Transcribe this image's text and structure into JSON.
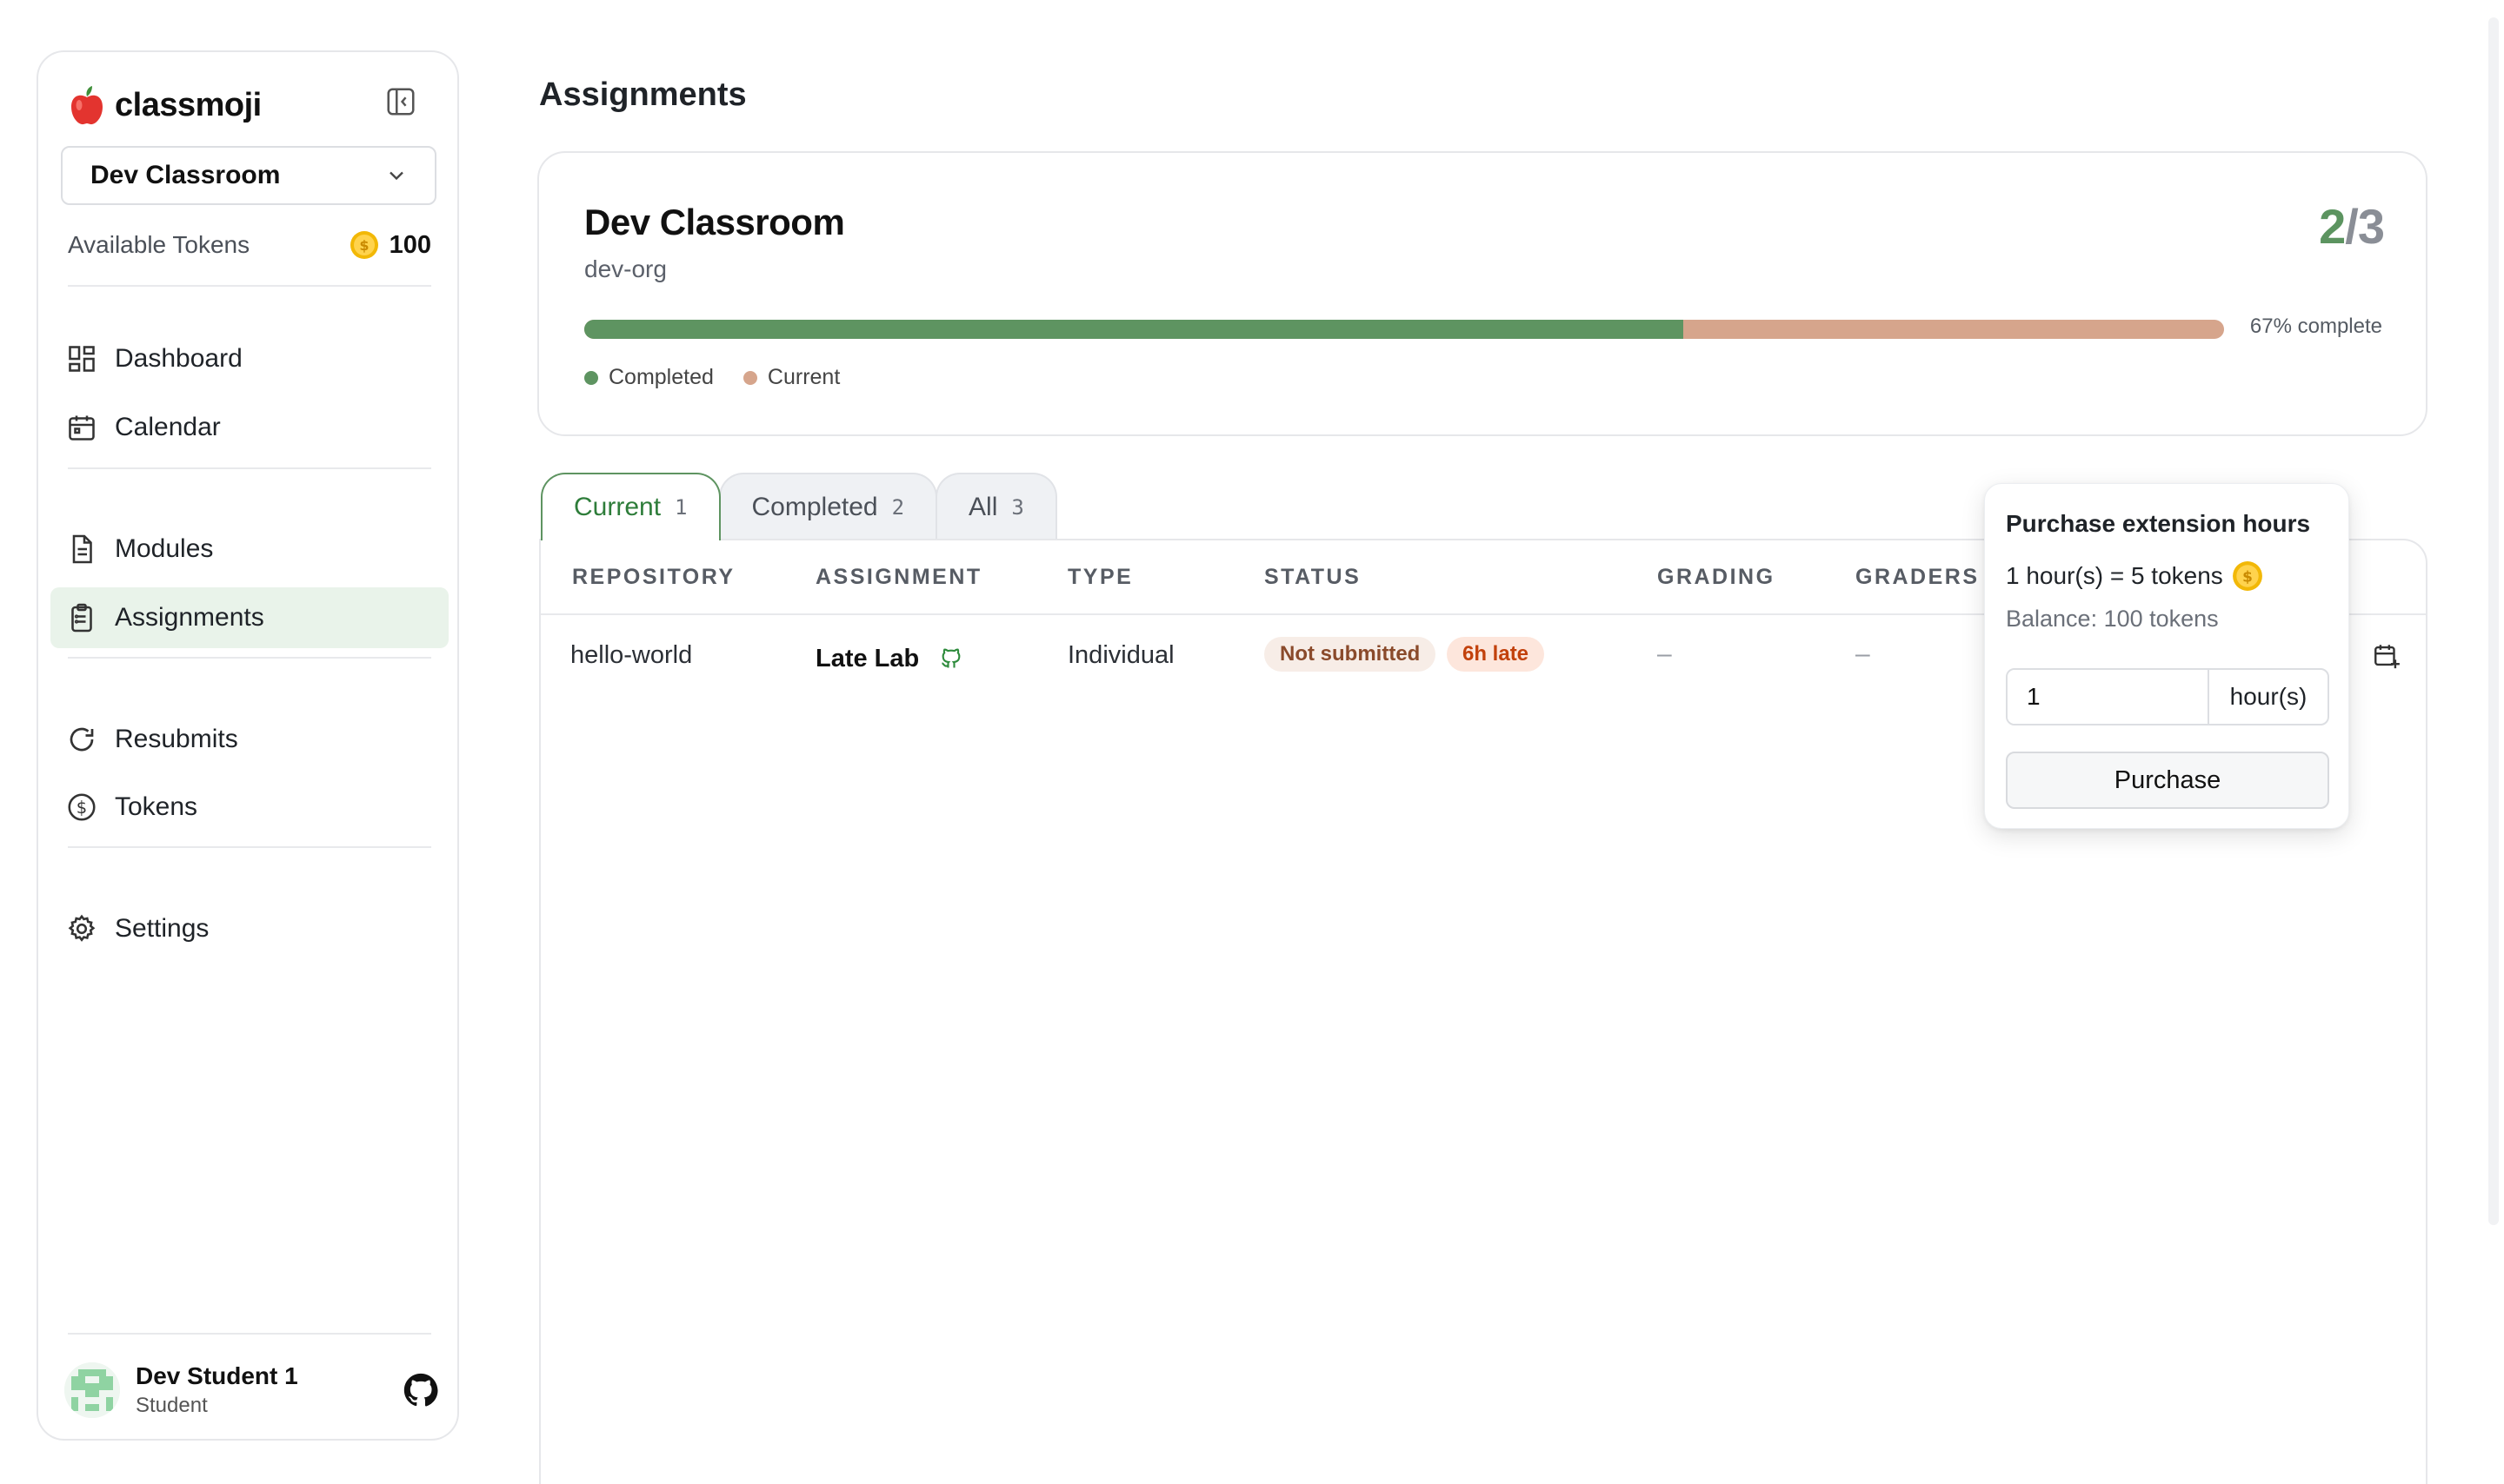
{
  "app": {
    "name": "classmoji"
  },
  "sidebar": {
    "classroom_select": "Dev Classroom",
    "tokens_label": "Available Tokens",
    "tokens_value": "100",
    "nav": {
      "dashboard": "Dashboard",
      "calendar": "Calendar",
      "modules": "Modules",
      "assignments": "Assignments",
      "resubmits": "Resubmits",
      "tokens": "Tokens",
      "settings": "Settings"
    },
    "user": {
      "name": "Dev Student 1",
      "role": "Student"
    }
  },
  "main": {
    "title": "Assignments",
    "classroom": {
      "name": "Dev Classroom",
      "org": "dev-org",
      "completed": "2",
      "total": "3",
      "progress_percent": 67,
      "percent_label": "67% complete",
      "legend": {
        "completed": "Completed",
        "current": "Current"
      }
    },
    "tabs": [
      {
        "label": "Current",
        "count": "1"
      },
      {
        "label": "Completed",
        "count": "2"
      },
      {
        "label": "All",
        "count": "3"
      }
    ],
    "table": {
      "columns": [
        "REPOSITORY",
        "ASSIGNMENT",
        "TYPE",
        "STATUS",
        "GRADING",
        "GRADERS"
      ],
      "rows": [
        {
          "repository": "hello-world",
          "assignment": "Late Lab",
          "type": "Individual",
          "status": "Not submitted",
          "late": "6h late",
          "grading": "–",
          "graders": "–"
        }
      ]
    }
  },
  "popover": {
    "title": "Purchase extension hours",
    "rate": "1 hour(s) = 5 tokens",
    "balance": "Balance: 100 tokens",
    "input_value": "1",
    "unit": "hour(s)",
    "button": "Purchase"
  },
  "colors": {
    "completed": "#5e9461",
    "current": "#d6a58c",
    "active_nav": "#e9f3ea",
    "late_badge_text": "#c2410c"
  }
}
